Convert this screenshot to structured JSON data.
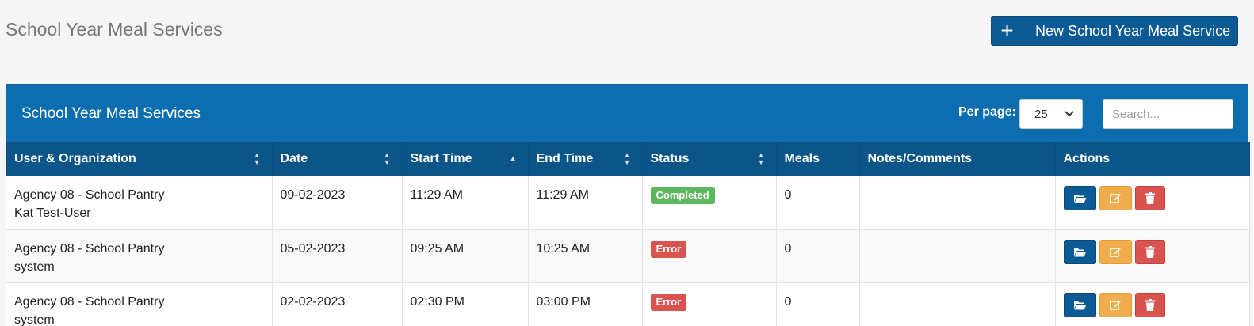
{
  "header": {
    "title": "School Year Meal Services",
    "new_button_icon": "plus-icon",
    "new_button_label": "New School Year Meal Service"
  },
  "panel": {
    "title": "School Year Meal Services",
    "per_page_label": "Per page:",
    "per_page_value": "25",
    "search_placeholder": "Search..."
  },
  "table": {
    "columns": [
      "User & Organization",
      "Date",
      "Start Time",
      "End Time",
      "Status",
      "Meals",
      "Notes/Comments",
      "Actions"
    ],
    "rows": [
      {
        "org": "Agency 08 - School Pantry",
        "user": "Kat Test-User",
        "date": "09-02-2023",
        "start": "11:29 AM",
        "end": "11:29 AM",
        "status": "Completed",
        "meals": "0",
        "notes": ""
      },
      {
        "org": "Agency 08 - School Pantry",
        "user": "system",
        "date": "05-02-2023",
        "start": "09:25 AM",
        "end": "10:25 AM",
        "status": "Error",
        "meals": "0",
        "notes": ""
      },
      {
        "org": "Agency 08 - School Pantry",
        "user": "system",
        "date": "02-02-2023",
        "start": "02:30 PM",
        "end": "03:00 PM",
        "status": "Error",
        "meals": "0",
        "notes": ""
      }
    ]
  },
  "colors": {
    "primary": "#0d6eaf",
    "header_dark": "#0c5589",
    "success": "#5cb85c",
    "error": "#d9534f",
    "warning": "#f0ad4e"
  }
}
